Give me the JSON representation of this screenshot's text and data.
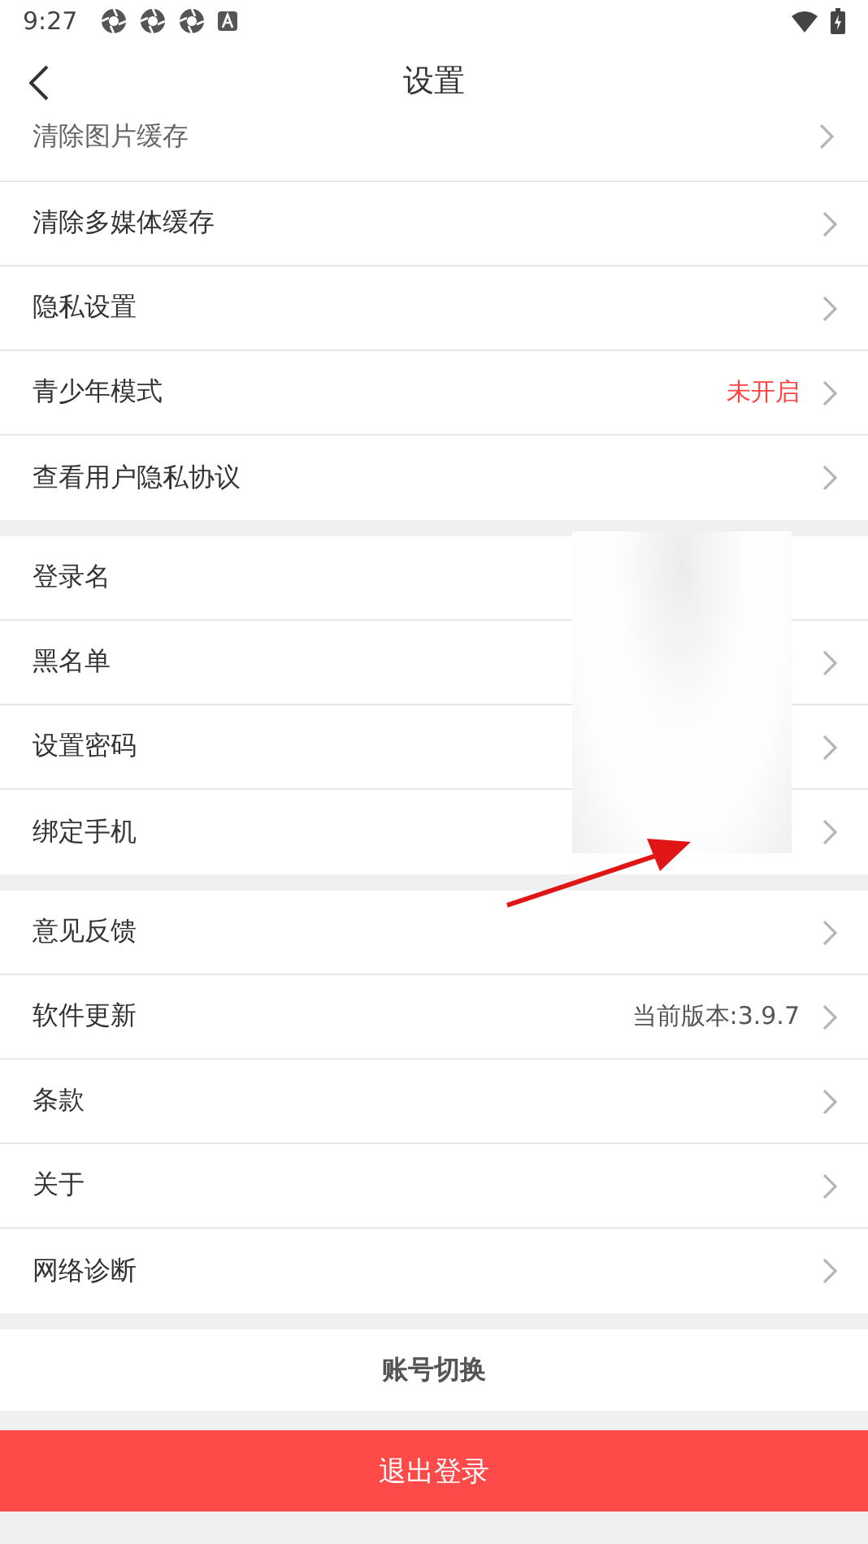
{
  "status_bar": {
    "time": "9:27"
  },
  "header": {
    "title": "设置"
  },
  "scrolled_row": {
    "label": "清除图片缓存"
  },
  "groups": [
    {
      "rows": [
        {
          "label": "清除多媒体缓存",
          "kind": "link"
        },
        {
          "label": "隐私设置",
          "kind": "link"
        },
        {
          "label": "青少年模式",
          "value": {
            "text": "未开启",
            "color": "#ff4343"
          },
          "kind": "link"
        },
        {
          "label": "查看用户隐私协议",
          "kind": "link"
        }
      ]
    },
    {
      "rows": [
        {
          "label": "登录名",
          "kind": "plain"
        },
        {
          "label": "黑名单",
          "kind": "link"
        },
        {
          "label": "设置密码",
          "kind": "link"
        },
        {
          "label": "绑定手机",
          "kind": "link"
        }
      ]
    },
    {
      "rows": [
        {
          "label": "意见反馈",
          "kind": "link"
        },
        {
          "label": "软件更新",
          "value": {
            "text": "当前版本:3.9.7",
            "color": "#555555"
          },
          "kind": "link"
        },
        {
          "label": "条款",
          "kind": "link"
        },
        {
          "label": "关于",
          "kind": "link"
        },
        {
          "label": "网络诊断",
          "kind": "link"
        }
      ]
    }
  ],
  "switch_account": {
    "label": "账号切换"
  },
  "logout": {
    "label": "退出登录"
  }
}
